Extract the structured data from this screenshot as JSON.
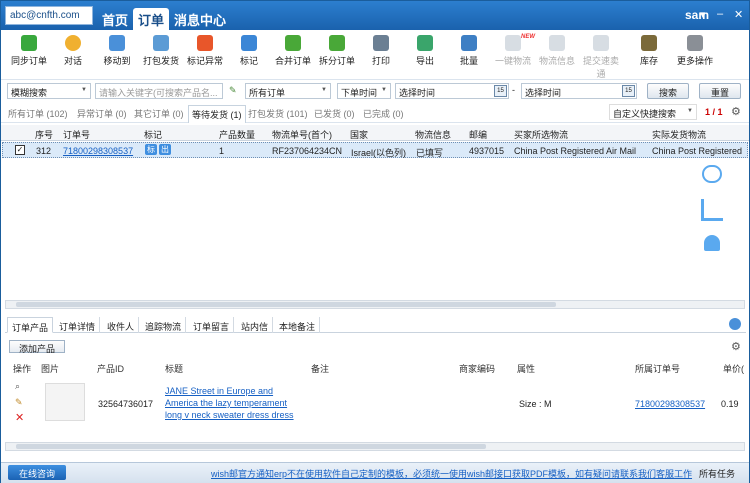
{
  "header": {
    "account": "abc@cnfth.com",
    "tabs": [
      "首页",
      "订单",
      "消息中心"
    ],
    "active_tab": 1,
    "user": "sam"
  },
  "toolbar": {
    "buttons": [
      "同步订单",
      "对话",
      "移动到",
      "打包发货",
      "标记异常",
      "标记",
      "合并订单",
      "拆分订单",
      "打印",
      "导出",
      "批量",
      "一键物流",
      "物流信息",
      "提交速卖通",
      "库存",
      "更多操作"
    ],
    "disabled": [
      11,
      12,
      13
    ],
    "new_badge": "NEW"
  },
  "search": {
    "mode": "模糊搜索",
    "keyword_placeholder": "请输入关键字(可搜索产品名...",
    "order_scope": "所有订单",
    "time_type": "下单时间",
    "start_placeholder": "选择时间",
    "end_placeholder": "选择时间",
    "search_label": "搜索",
    "reset_label": "重置",
    "date_badge": "15",
    "dash": "-"
  },
  "filters": {
    "tabs": [
      "所有订单 (102)",
      "异常订单 (0)",
      "其它订单 (0)",
      "等待发货 (1)",
      "打包发货 (101)",
      "已发货 (0)",
      "已完成 (0)"
    ],
    "active": 3,
    "quick_search": "自定义快捷搜索",
    "pager": "1 / 1"
  },
  "grid": {
    "columns": [
      "序号",
      "订单号",
      "标记",
      "产品数量",
      "物流单号(首个)",
      "国家",
      "物流信息",
      "邮编",
      "买家所选物流",
      "实际发货物流"
    ],
    "rows": [
      {
        "seq": "312",
        "order_no": "71800298308537",
        "tags": [
          "标",
          "出"
        ],
        "qty": "1",
        "tracking": "RF237064234CN",
        "country": "Israel(以色列)",
        "logistics_info": "已填写",
        "zip": "4937015",
        "buyer_logistics": "China Post Registered Air Mail",
        "actual_logistics": "China Post Registered"
      }
    ]
  },
  "detail": {
    "tabs": [
      "订单产品",
      "订单详情",
      "收件人",
      "追踪物流",
      "订单留言",
      "站内信",
      "本地备注"
    ],
    "add_product": "添加产品",
    "columns": [
      "操作",
      "图片",
      "产品ID",
      "标题",
      "备注",
      "商家编码",
      "属性",
      "所属订单号",
      "单价("
    ],
    "product": {
      "id": "32564736017",
      "title_lines": [
        "JANE Street in Europe and",
        "America the lazy temperament",
        "long v neck sweater dress dress"
      ],
      "attr": "Size : M",
      "order_no": "71800298308537",
      "price": "0.19"
    }
  },
  "status": {
    "consult": "在线咨询",
    "notice": "wish邮官方通知erp不在使用软件自己定制的模板，必须统一使用wish邮接口获取PDF模板，如有疑问请联系我们客服工作",
    "all_tasks": "所有任务"
  },
  "colors": {
    "titlebar": "#1f6fbf",
    "accent": "#1660c4",
    "selected_row": "#dbeaf9",
    "pager": "#cc0000"
  }
}
